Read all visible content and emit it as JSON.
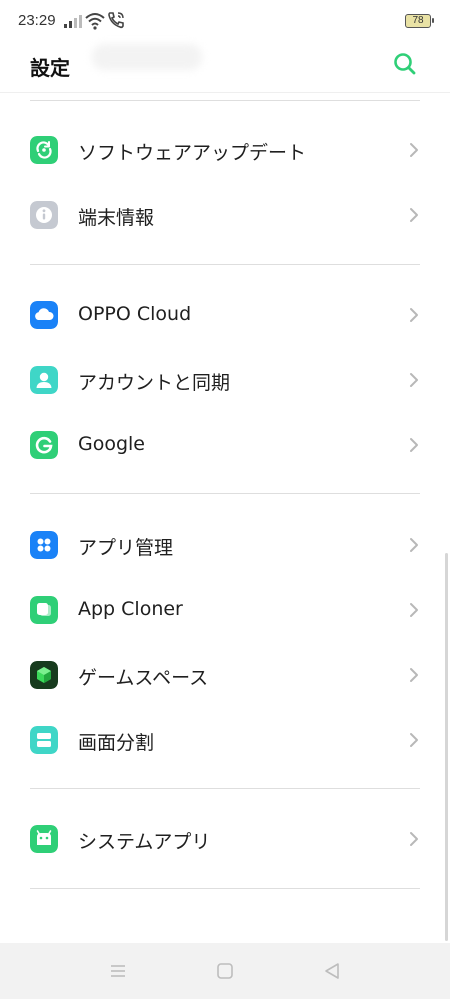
{
  "status": {
    "time": "23:29",
    "battery": "78"
  },
  "header": {
    "title": "設定"
  },
  "items": [
    {
      "label": "ソフトウェアアップデート",
      "icon": "software-update-icon",
      "color": "#2fcf77"
    },
    {
      "label": "端末情報",
      "icon": "info-icon",
      "color": "#c5c9d1"
    },
    {
      "label": "OPPO Cloud",
      "icon": "cloud-icon",
      "color": "#1a82f7"
    },
    {
      "label": "アカウントと同期",
      "icon": "account-icon",
      "color": "#3fd6c7"
    },
    {
      "label": "Google",
      "icon": "google-icon",
      "color": "#2fcf77"
    },
    {
      "label": "アプリ管理",
      "icon": "app-management-icon",
      "color": "#1a82f7"
    },
    {
      "label": "App Cloner",
      "icon": "app-cloner-icon",
      "color": "#2fcf77"
    },
    {
      "label": "ゲームスペース",
      "icon": "game-space-icon",
      "color": "#1d5a2a"
    },
    {
      "label": "画面分割",
      "icon": "split-screen-icon",
      "color": "#3fd6c7"
    },
    {
      "label": "システムアプリ",
      "icon": "system-apps-icon",
      "color": "#2fcf77"
    }
  ],
  "accent": "#2fcf77"
}
